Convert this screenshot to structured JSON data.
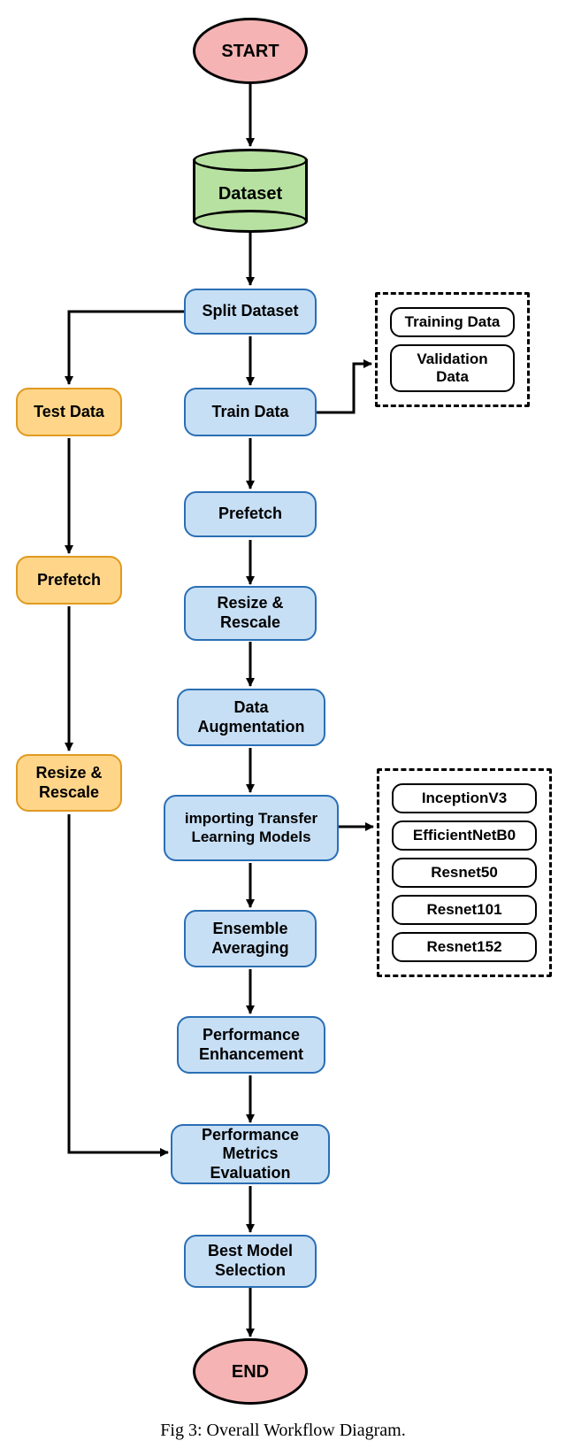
{
  "nodes": {
    "start": "START",
    "dataset": "Dataset",
    "split": "Split Dataset",
    "train": "Train Data",
    "test": "Test Data",
    "prefetch_train": "Prefetch",
    "prefetch_test": "Prefetch",
    "resize_train": "Resize & Rescale",
    "resize_test": "Resize & Rescale",
    "augment": "Data Augmentation",
    "import_models": "importing Transfer Learning Models",
    "ensemble": "Ensemble Averaging",
    "perf_enh": "Performance Enhancement",
    "perf_eval": "Performance Metrics Evaluation",
    "best_model": "Best Model Selection",
    "end": "END"
  },
  "group_split": {
    "training": "Training Data",
    "validation": "Validation Data"
  },
  "group_models": {
    "inception": "InceptionV3",
    "efficientnet": "EfficientNetB0",
    "resnet50": "Resnet50",
    "resnet101": "Resnet101",
    "resnet152": "Resnet152"
  },
  "caption": "Fig 3: Overall Workflow Diagram."
}
